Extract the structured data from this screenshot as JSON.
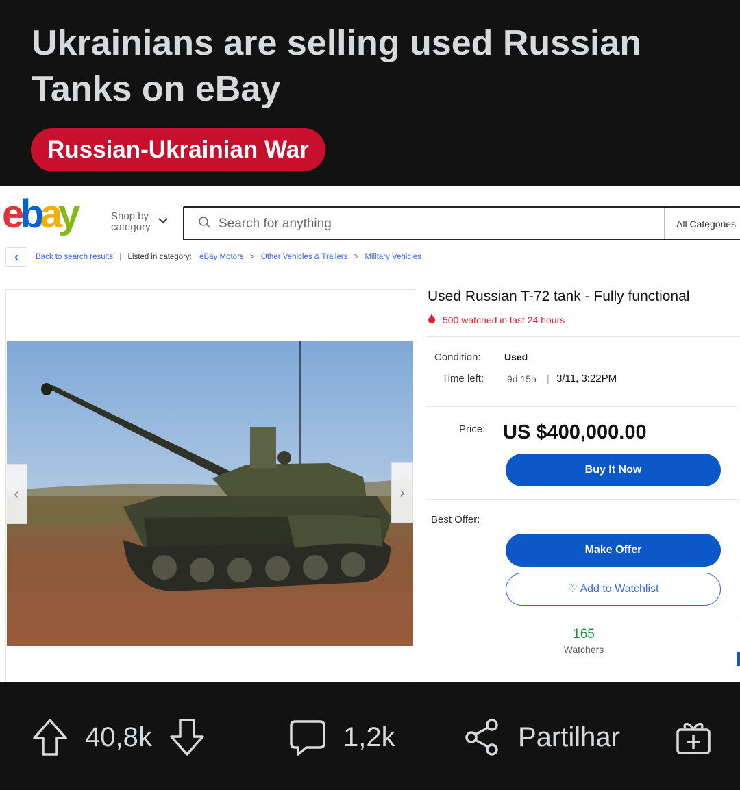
{
  "post": {
    "title": "Ukrainians are selling used Russian Tanks on eBay",
    "flair": "Russian-Ukrainian War"
  },
  "ebay": {
    "logo": [
      "e",
      "b",
      "a",
      "y"
    ],
    "logo_colors": [
      "#e53238",
      "#0064d2",
      "#f5af02",
      "#86b817"
    ],
    "shop_by": "Shop by category",
    "search_placeholder": "Search for anything",
    "search_category": "All Categories",
    "breadcrumb": {
      "back": "Back to search results",
      "listed": "Listed in category:",
      "crumbs": [
        "eBay Motors",
        "Other Vehicles & Trailers",
        "Military Vehicles"
      ]
    },
    "listing": {
      "title": "Used Russian T-72 tank - Fully functional",
      "watched": "500 watched in last 24 hours",
      "condition_label": "Condition:",
      "condition_value": "Used",
      "time_left_label": "Time left:",
      "time_left_value": "9d 15h",
      "time_left_date": "3/11, 3:22PM",
      "price_label": "Price:",
      "price": "US $400,000.00",
      "buy_now": "Buy It Now",
      "best_offer_label": "Best Offer:",
      "make_offer": "Make Offer",
      "watchlist": "Add to Watchlist",
      "watchers_count": "165",
      "watchers_label": "Watchers"
    }
  },
  "actions": {
    "upvotes": "40,8k",
    "comments": "1,2k",
    "share": "Partilhar"
  },
  "colors": {
    "background": "#121212",
    "flair": "#c8102e",
    "ebay_blue": "#0c58c8",
    "watched_red": "#dd1e31",
    "watchers_green": "#1f8c3b"
  }
}
